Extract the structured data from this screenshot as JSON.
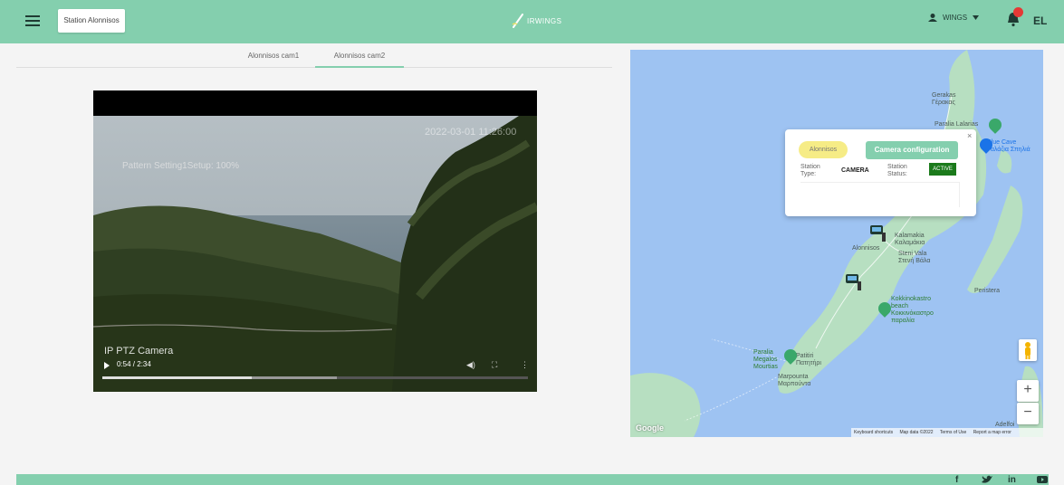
{
  "header": {
    "station_button": "Station Alonnisos",
    "logo_text": "IRWINGS",
    "user_name": "WINGS",
    "language": "EL"
  },
  "tabs": [
    {
      "label": "Alonnisos cam1",
      "active": false
    },
    {
      "label": "Alonnisos cam2",
      "active": true
    }
  ],
  "video": {
    "timestamp": "2022-03-01 11:26:00",
    "overlay_text": "Pattern Setting1Setup: 100%",
    "camera_label": "IP PTZ Camera",
    "time_display": "0:54 / 2:34",
    "played_fraction": 0.35,
    "buffered_fraction": 0.55
  },
  "map": {
    "popup": {
      "station_name": "Alonnisos",
      "config_button": "Camera configuration",
      "type_label": "Station Type:",
      "type_value": "CAMERA",
      "status_label": "Station Status:",
      "status_value": "ACTIVE",
      "close": "×"
    },
    "labels": {
      "gerakas": "Gerakas\nΓέρακας",
      "paralia_lalarias": "Paralia Lalarias",
      "blue_cave": "Blue Cave\nΓαλάζια Σπηλιά",
      "kalamakia": "Kalamakia\nΚαλαμάκια",
      "alonnisos": "Alonnisos",
      "steni_vala": "Steni Vala\nΣτενή Βάλα",
      "peristera": "Peristera",
      "kokkinokastro": "Kokkinokastro\nbeach\nΚοκκινόκαστρο\nπαραλία",
      "paralia_megalos": "Paralia\nMegalos\nMourtias",
      "patitiri": "Patitiri\nΠατητήρι",
      "marpounta": "Marpounta\nΜαρπούντα",
      "adelfoi": "Adelfoi"
    },
    "zoom_in": "+",
    "zoom_out": "−",
    "google_logo": "Google",
    "attribution": [
      "Keyboard shortcuts",
      "Map data ©2022",
      "Terms of Use",
      "Report a map error"
    ]
  },
  "footer": {
    "social": [
      "f",
      "t",
      "in",
      "yt"
    ]
  },
  "colors": {
    "accent": "#84cfae",
    "active_badge": "#1b7a1b",
    "pill": "#f6ec86",
    "notification": "#e53935"
  }
}
